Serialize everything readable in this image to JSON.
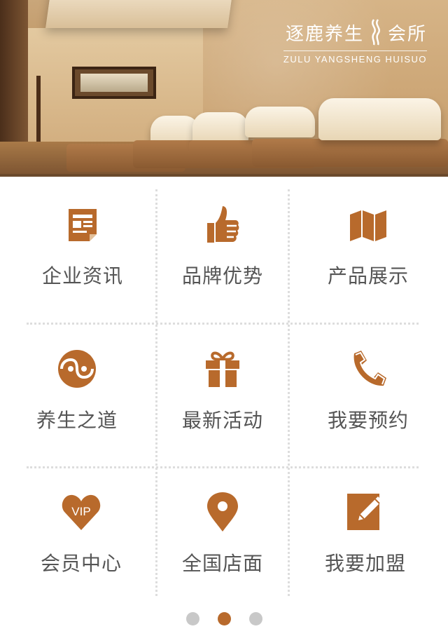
{
  "brand": {
    "logo_cn": "逐鹿养生",
    "logo_cn_suffix": "会所",
    "logo_en": "ZULU YANGSHENG HUISUO",
    "accent_color": "#b86a2c"
  },
  "menu": [
    {
      "label": "企业资讯",
      "icon": "newspaper-icon"
    },
    {
      "label": "品牌优势",
      "icon": "thumbs-up-icon"
    },
    {
      "label": "产品展示",
      "icon": "map-icon"
    },
    {
      "label": "养生之道",
      "icon": "yin-yang-icon"
    },
    {
      "label": "最新活动",
      "icon": "gift-icon"
    },
    {
      "label": "我要预约",
      "icon": "phone-icon"
    },
    {
      "label": "会员中心",
      "icon": "vip-heart-icon"
    },
    {
      "label": "全国店面",
      "icon": "location-pin-icon"
    },
    {
      "label": "我要加盟",
      "icon": "edit-icon"
    }
  ],
  "pagination": {
    "total": 3,
    "active_index": 1
  }
}
